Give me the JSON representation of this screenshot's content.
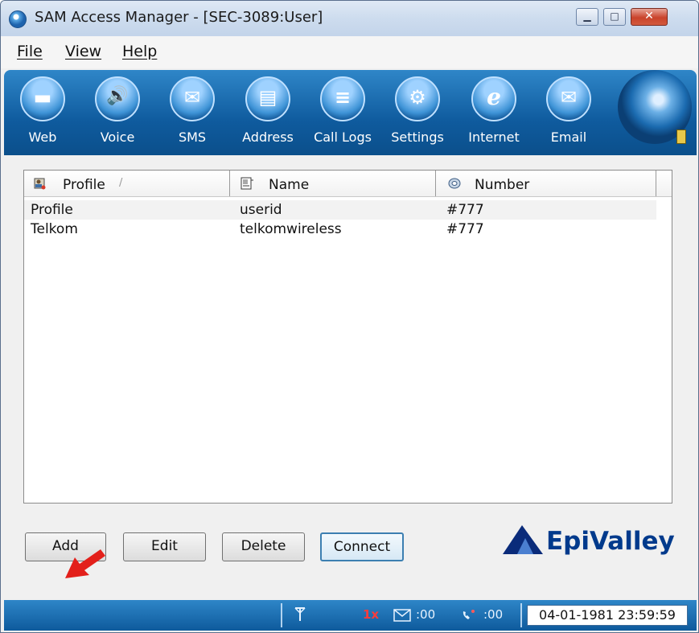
{
  "window": {
    "title": "SAM Access Manager - [SEC-3089:User]",
    "controls": {
      "minimize": "▁",
      "maximize": "□",
      "close": "✕"
    }
  },
  "menu": [
    "File",
    "View",
    "Help"
  ],
  "toolbar": {
    "items": [
      {
        "label": "Web",
        "icon": "web-icon",
        "glyph": "▬"
      },
      {
        "label": "Voice",
        "icon": "speaker-icon",
        "glyph": "🔊"
      },
      {
        "label": "SMS",
        "icon": "envelope-icon",
        "glyph": "✉"
      },
      {
        "label": "Address",
        "icon": "address-book-icon",
        "glyph": "▤"
      },
      {
        "label": "Call Logs",
        "icon": "call-log-icon",
        "glyph": "≡"
      },
      {
        "label": "Settings",
        "icon": "gear-icon",
        "glyph": "⚙"
      },
      {
        "label": "Internet",
        "icon": "internet-explorer-icon",
        "glyph": "e"
      },
      {
        "label": "Email",
        "icon": "email-icon",
        "glyph": "✉"
      }
    ]
  },
  "list": {
    "columns": [
      {
        "label": "Profile",
        "icon": "profile-icon",
        "sort": "/"
      },
      {
        "label": "Name",
        "icon": "name-icon"
      },
      {
        "label": "Number",
        "icon": "number-icon"
      }
    ],
    "rows": [
      {
        "profile": "Profile",
        "name": "userid",
        "number": "#777"
      },
      {
        "profile": "Telkom",
        "name": "telkomwireless",
        "number": "#777"
      }
    ]
  },
  "buttons": {
    "add": "Add",
    "edit": "Edit",
    "delete": "Delete",
    "connect": "Connect"
  },
  "logo": {
    "text": "EpiValley"
  },
  "status": {
    "network": "1x",
    "sms_count": ":00",
    "voicemail_count": ":00",
    "datetime": "04-01-1981 23:59:59"
  },
  "colors": {
    "toolbar": "#0f5b9e",
    "status_bar": "#1b6bb0",
    "logo": "#003a8c",
    "annotation_arrow": "#e3201b"
  }
}
